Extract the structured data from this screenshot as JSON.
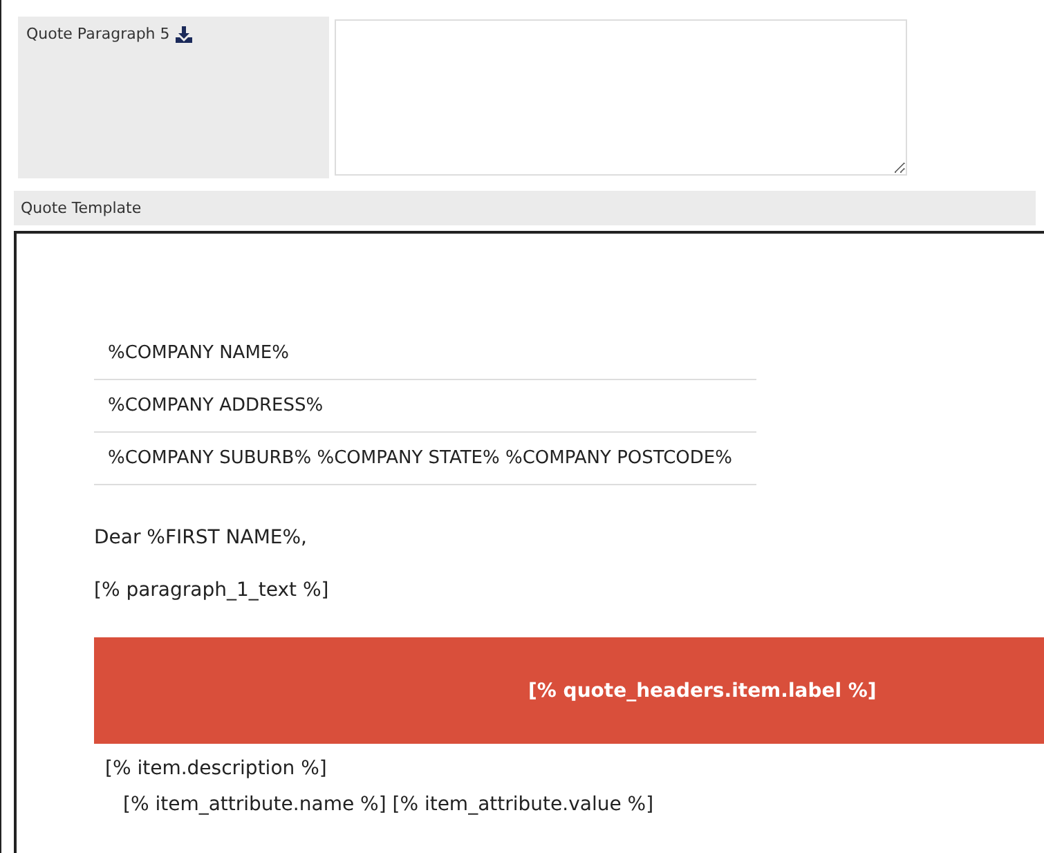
{
  "paragraph_field": {
    "label": "Quote Paragraph 5"
  },
  "template": {
    "title": "Quote Template",
    "address_lines": [
      "%COMPANY NAME%",
      "%COMPANY ADDRESS%",
      "%COMPANY SUBURB% %COMPANY STATE% %COMPANY POSTCODE%"
    ],
    "greeting": "Dear %FIRST NAME%,",
    "paragraph": "[% paragraph_1_text %]",
    "header_label": "[% quote_headers.item.label %]",
    "item_description": "[% item.description %]",
    "item_attribute": "[% item_attribute.name %] [% item_attribute.value %]"
  }
}
